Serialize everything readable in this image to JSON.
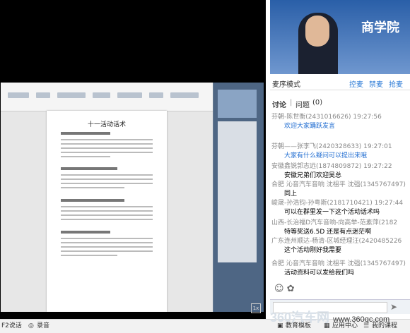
{
  "video": {
    "banner": "商学院"
  },
  "controls": {
    "mode": "麦序模式",
    "actions": [
      "控麦",
      "禁麦",
      "抢麦"
    ]
  },
  "chat_tabs": [
    "讨论",
    "问题",
    "(0)"
  ],
  "messages": [
    {
      "sender": "芬朝-陈世衡(2431016626) 19:27:56",
      "text": "欢迎大家踊跃发言",
      "color": "blue"
    },
    {
      "sender": "芬朝——张李飞(2420328633) 19:27:01",
      "text": "大家有什么疑问可以提出来哦",
      "color": "blue"
    },
    {
      "sender": "安徽鑫锐郭志远(1874809872) 19:27:22",
      "text": "安徽兄弟们欢迎吴总",
      "color": "black"
    },
    {
      "sender": "合肥 沁音汽车音响 沈祖平 沈强(1345767497)",
      "text": "同上",
      "color": "black"
    },
    {
      "sender": "峻晟-孙浩钧-孙粤斯(2181710421) 19:27:44",
      "text": "可以在群里发一下这个活动话术吗",
      "color": "black"
    },
    {
      "sender": "山西-长治福D汽车音响-向高举-范素萍(2182",
      "text": "特等奖送6.5D 还是有点迷茫啊",
      "color": "black"
    },
    {
      "sender": "广东连州顺达-杨清-区城经理汪(2420485226",
      "text": "这个活动刚好我需要",
      "color": "black"
    },
    {
      "sender": "合肥 沁音汽车音响 沈祖平 沈强(1345767497)",
      "text": "活动资料可以发给我们吗",
      "color": "black"
    }
  ],
  "document": {
    "title": "十一活动话术"
  },
  "bottom": {
    "f2": "F2说话",
    "record": "录音",
    "template": "教育模板",
    "app": "应用中心",
    "course": "我的课程"
  },
  "watermark": {
    "brand": "360汽车网",
    "url": "www.360qc.com"
  }
}
